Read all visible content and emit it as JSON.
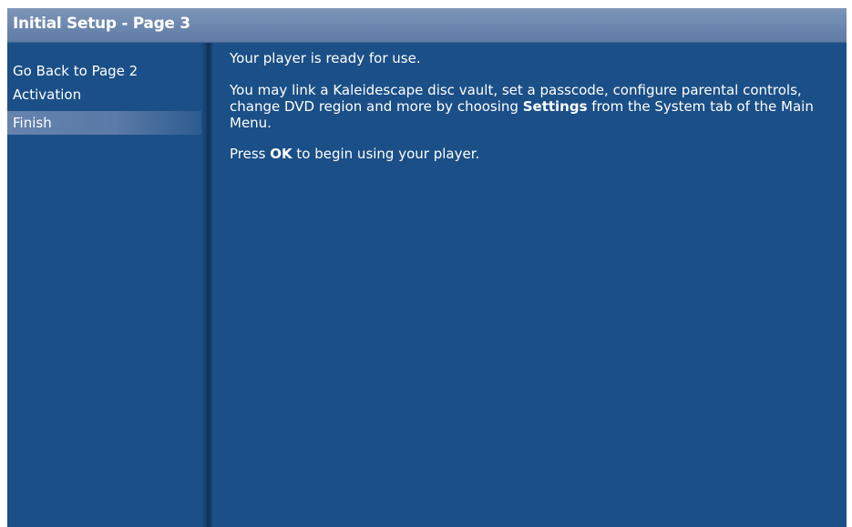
{
  "window": {
    "title": "Initial Setup - Page 3"
  },
  "sidebar": {
    "items": [
      {
        "label": "Go Back to Page 2",
        "selected": false
      },
      {
        "label": "Activation",
        "selected": false
      },
      {
        "label": "Finish",
        "selected": true
      }
    ]
  },
  "main": {
    "ready_text": "Your player is ready for use.",
    "settings_text_before": "You may link a Kaleidescape disc vault, set a passcode, configure parental controls, change DVD region and more by choosing ",
    "settings_keyword": "Settings",
    "settings_text_after": " from the System tab of the Main Menu.",
    "press_text_before": "Press ",
    "ok_keyword": "OK",
    "press_text_after": " to begin using your player."
  },
  "colors": {
    "background": "#1b4f87",
    "title_bar": "#6a87b0",
    "selected_item": "#6583ad",
    "text": "#ffffff"
  }
}
